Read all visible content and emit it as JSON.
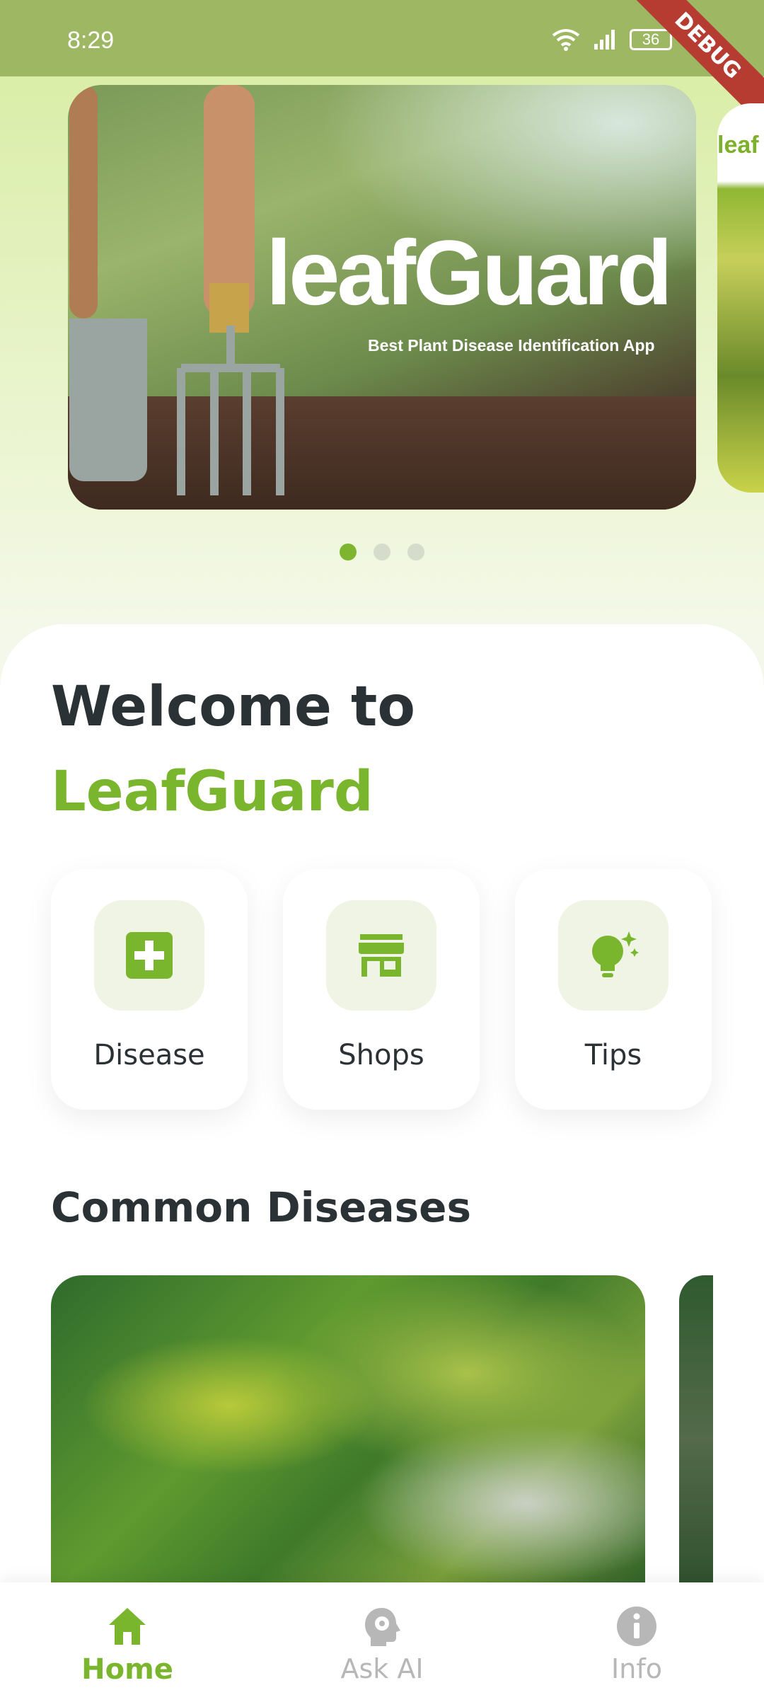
{
  "status_bar": {
    "time": "8:29",
    "battery": "36",
    "debug_label": "DEBUG"
  },
  "carousel": {
    "slides": [
      {
        "brand": "leafGuard",
        "tagline": "Best Plant Disease Identification App"
      },
      {
        "brand": "leaf"
      }
    ],
    "active_index": 0,
    "count": 3
  },
  "welcome": {
    "line1": "Welcome to",
    "brand": "LeafGuard"
  },
  "features": [
    {
      "label": "Disease",
      "icon": "medical-plus-icon"
    },
    {
      "label": "Shops",
      "icon": "store-icon"
    },
    {
      "label": "Tips",
      "icon": "lightbulb-icon"
    }
  ],
  "common_diseases": {
    "title": "Common Diseases"
  },
  "bottom_nav": {
    "items": [
      {
        "label": "Home",
        "icon": "home-icon",
        "active": true
      },
      {
        "label": "Ask AI",
        "icon": "ai-head-icon",
        "active": false
      },
      {
        "label": "Info",
        "icon": "info-icon",
        "active": false
      }
    ]
  },
  "colors": {
    "accent": "#7ab52e",
    "status_bar": "#9eb763",
    "text_dark": "#2b3235",
    "inactive": "#b7b7b7",
    "icon_bg": "#f0f4e4"
  }
}
